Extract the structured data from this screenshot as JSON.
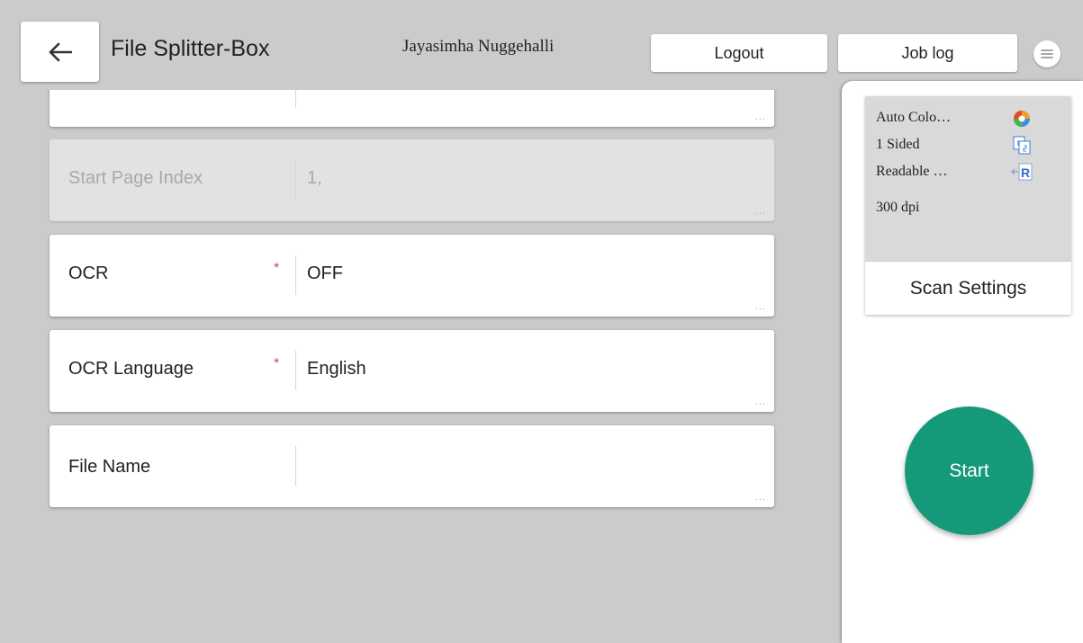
{
  "header": {
    "title": "File Splitter-Box",
    "user_name": "Jayasimha Nuggehalli",
    "logout_label": "Logout",
    "joblog_label": "Job log"
  },
  "fields": [
    {
      "label": "Start Page Index",
      "value": "1,",
      "required": false,
      "disabled": true
    },
    {
      "label": "OCR",
      "value": "OFF",
      "required": true,
      "disabled": false
    },
    {
      "label": "OCR Language",
      "value": "English",
      "required": true,
      "disabled": false
    },
    {
      "label": "File Name",
      "value": "",
      "required": false,
      "disabled": false
    }
  ],
  "required_mark": "*",
  "more_mark": "...",
  "scan_settings": {
    "items": [
      {
        "text": "Auto Colo…",
        "icon": "auto-color-icon"
      },
      {
        "text": "1 Sided",
        "icon": "one-sided-icon"
      },
      {
        "text": "Readable …",
        "icon": "readable-orientation-icon"
      },
      {
        "text": "300 dpi",
        "icon": ""
      }
    ],
    "button_label": "Scan Settings"
  },
  "start_label": "Start",
  "colors": {
    "accent": "#14997a",
    "background": "#cbcbcb",
    "required": "#e04545"
  }
}
